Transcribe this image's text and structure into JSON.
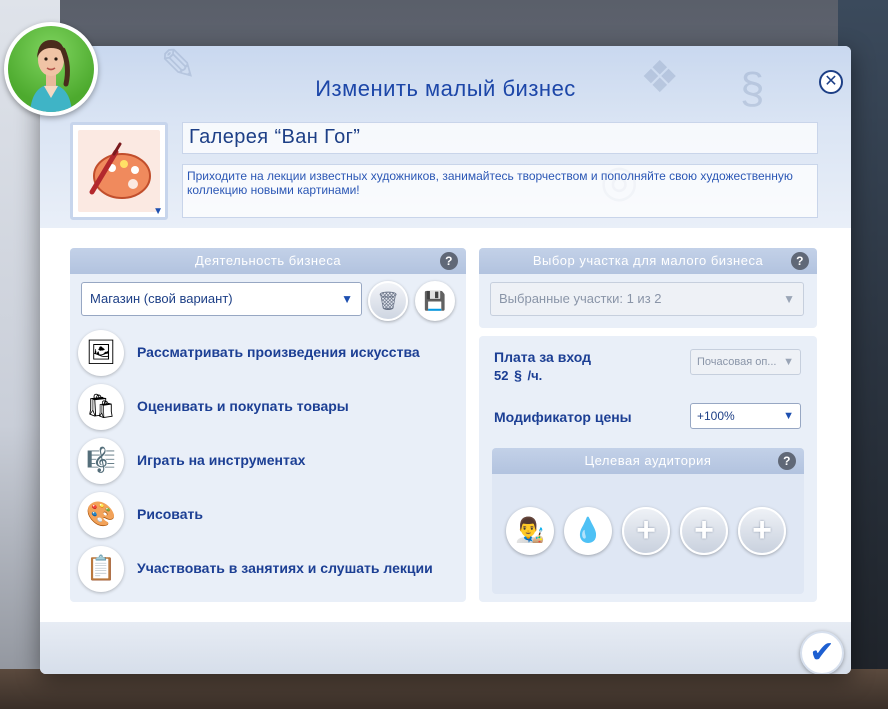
{
  "dialog": {
    "title": "Изменить малый бизнес",
    "close_glyph": "✕",
    "confirm_glyph": "✔"
  },
  "business": {
    "icon": "palette-icon",
    "name": "Галерея “Ван Гог”",
    "description": "Приходите на лекции известных художников, занимайтесь творчеством и пополняйте свою художественную коллекцию новыми картинами!"
  },
  "activities_panel": {
    "header": "Деятельность бизнеса",
    "help": "?",
    "type_dropdown": "Магазин (свой вариант)",
    "items": [
      {
        "label": "Рассматривать произведения искусства",
        "icon": "painting-icon",
        "glyph": "🖼"
      },
      {
        "label": "Оценивать и покупать товары",
        "icon": "shopping-bag-icon",
        "glyph": "🛍"
      },
      {
        "label": "Играть на инструментах",
        "icon": "harp-icon",
        "glyph": "🎼"
      },
      {
        "label": "Рисовать",
        "icon": "palette-icon",
        "glyph": "🎨"
      },
      {
        "label": "Участвовать в занятиях и слушать лекции",
        "icon": "chalkboard-icon",
        "glyph": "📋"
      }
    ]
  },
  "lot_panel": {
    "header": "Выбор участка для малого бизнеса",
    "help": "?",
    "selected_lots": "Выбранные участки: 1 из 2"
  },
  "pricing": {
    "entry_fee_label": "Плата за вход",
    "entry_fee_value": "52",
    "entry_fee_unit": "/ч.",
    "entry_fee_dropdown": "Почасовая оп...",
    "price_modifier_label": "Модификатор цены",
    "price_modifier_value": "+100%"
  },
  "audience": {
    "header": "Целевая аудитория",
    "help": "?",
    "slots": [
      {
        "state": "filled",
        "icon": "artist-trait-icon",
        "glyph": "👨‍🎨"
      },
      {
        "state": "filled",
        "icon": "creative-trait-icon",
        "glyph": "💧"
      },
      {
        "state": "empty",
        "icon": "plus-icon",
        "glyph": "+"
      },
      {
        "state": "empty",
        "icon": "plus-icon",
        "glyph": "+"
      },
      {
        "state": "empty",
        "icon": "plus-icon",
        "glyph": "+"
      }
    ]
  },
  "colors": {
    "title_blue": "#1c46a8",
    "label_blue": "#1c3f94",
    "panel_bg": "#e9eff8",
    "panel_header": "#b2c3df"
  }
}
